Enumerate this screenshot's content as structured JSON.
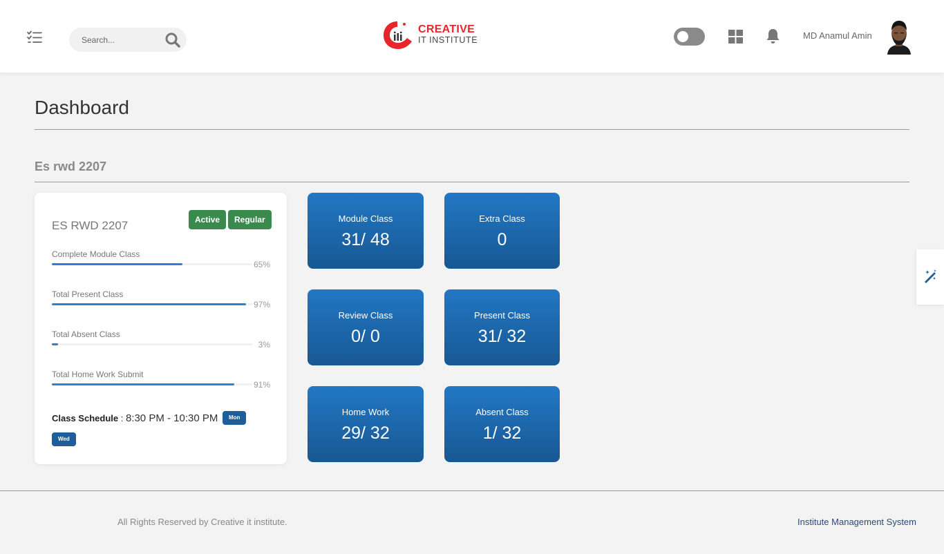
{
  "header": {
    "search_placeholder": "Search...",
    "brand_top": "CREATIVE",
    "brand_bottom": "IT INSTITUTE",
    "user_name": "MD Anamul Amin",
    "icons": {
      "menu": "menu-list-icon",
      "search": "search-icon",
      "toggle": "theme-toggle",
      "grid": "grid-icon",
      "bell": "bell-icon"
    }
  },
  "page": {
    "title": "Dashboard",
    "batch_title": "Es rwd 2207"
  },
  "course_card": {
    "name": "ES RWD 2207",
    "badges": [
      "Active",
      "Regular"
    ],
    "stats": [
      {
        "label": "Complete Module Class",
        "percent": "65%",
        "value": 0.65
      },
      {
        "label": "Total Present Class",
        "percent": "97%",
        "value": 0.97
      },
      {
        "label": "Total Absent Class",
        "percent": "3%",
        "value": 0.03
      },
      {
        "label": "Total Home Work Submit",
        "percent": "91%",
        "value": 0.91
      }
    ],
    "schedule_label": "Class Schedule",
    "schedule_sep": " : ",
    "schedule_time": "8:30 PM - 10:30 PM",
    "schedule_days": [
      "Mon",
      "Wed"
    ]
  },
  "tiles": [
    {
      "label": "Module Class",
      "value": "31/ 48"
    },
    {
      "label": "Extra Class",
      "value": "0"
    },
    {
      "label": "Review Class",
      "value": "0/ 0"
    },
    {
      "label": "Present Class",
      "value": "31/ 32"
    },
    {
      "label": "Home Work",
      "value": "29/ 32"
    },
    {
      "label": "Absent Class",
      "value": "1/ 32"
    }
  ],
  "footer": {
    "copyright": "All Rights Reserved by Creative it institute.",
    "link": "Institute Management System"
  },
  "colors": {
    "tile_top": "#2277c4",
    "tile_bottom": "#175893",
    "badge_green": "#3a8a4e",
    "progress_blue": "#2c7fd6",
    "brand_red": "#e6262b",
    "day_badge": "#1e5e9a"
  }
}
